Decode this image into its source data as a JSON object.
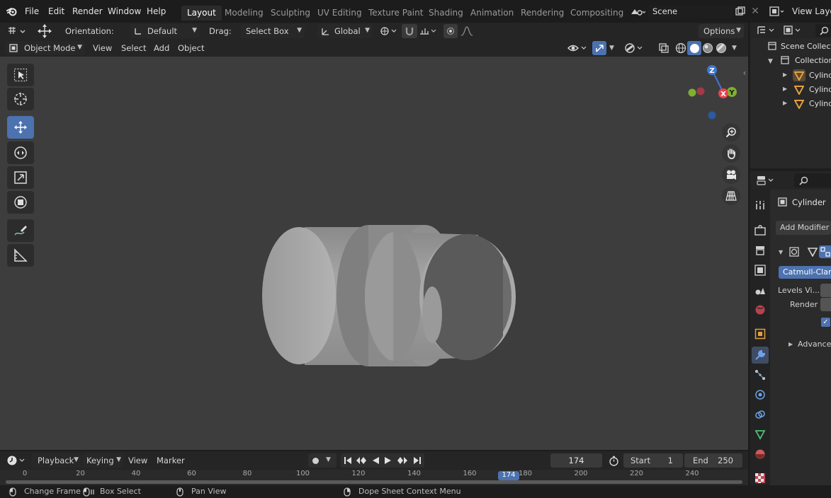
{
  "topbar": {
    "menus": [
      "File",
      "Edit",
      "Render",
      "Window",
      "Help"
    ],
    "workspaces": [
      "Layout",
      "Modeling",
      "Sculpting",
      "UV Editing",
      "Texture Paint",
      "Shading",
      "Animation",
      "Rendering",
      "Compositing"
    ],
    "active_workspace": "Layout",
    "scene_label": "Scene",
    "view_layer_label": "View Layer"
  },
  "tool_header": {
    "orientation_label": "Orientation:",
    "orientation_value": "Default",
    "drag_label": "Drag:",
    "drag_value": "Select Box",
    "transform_value": "Global",
    "options_label": "Options"
  },
  "view_header": {
    "mode": "Object Mode",
    "menus": [
      "View",
      "Select",
      "Add",
      "Object"
    ]
  },
  "timeline": {
    "menus": [
      "Playback",
      "Keying",
      "View",
      "Marker"
    ],
    "current_frame": "174",
    "start_label": "Start",
    "start_value": "1",
    "end_label": "End",
    "end_value": "250",
    "ruler_ticks": [
      "0",
      "20",
      "40",
      "60",
      "80",
      "100",
      "120",
      "140",
      "160",
      "180",
      "200",
      "220",
      "240"
    ],
    "playhead_label": "174"
  },
  "statusbar": {
    "items": [
      "Change Frame",
      "Box Select",
      "Pan View",
      "Dope Sheet Context Menu"
    ]
  },
  "outliner": {
    "scene_collection": "Scene Collection",
    "collection": "Collection",
    "objects": [
      "Cylinder",
      "Cylinder",
      "Cylinder"
    ]
  },
  "properties": {
    "object_name": "Cylinder",
    "add_modifier_label": "Add Modifier",
    "modifier_type": "Catmull-Clark",
    "levels_viewport_label": "Levels Vi...",
    "render_label": "Render",
    "advanced_label": "Advanced"
  },
  "gizmo": {
    "z_label": "Z",
    "y_label": "Y",
    "x_label": "X",
    "x_color": "#e8424f",
    "y_color": "#7fb02f",
    "z_color": "#3f78d6"
  },
  "colors": {
    "accent": "#4c72b0",
    "viewport_bg": "#3d3d3d",
    "object_orange": "#e2a03e"
  }
}
